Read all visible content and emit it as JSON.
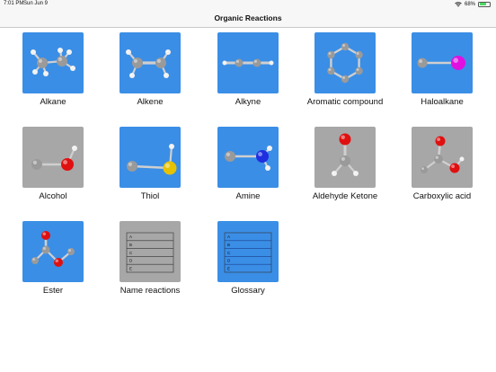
{
  "status": {
    "time": "7:01 PM",
    "date": "Sun Jun 9",
    "battery": "68%",
    "battery_level": 0.68
  },
  "nav": {
    "title": "Organic Reactions"
  },
  "tiles": [
    {
      "label": "Alkane",
      "icon": "alkane-molecule-icon",
      "bg": "blue"
    },
    {
      "label": "Alkene",
      "icon": "alkene-molecule-icon",
      "bg": "blue"
    },
    {
      "label": "Alkyne",
      "icon": "alkyne-molecule-icon",
      "bg": "blue"
    },
    {
      "label": "Aromatic compound",
      "icon": "aromatic-molecule-icon",
      "bg": "blue"
    },
    {
      "label": "Haloalkane",
      "icon": "haloalkane-molecule-icon",
      "bg": "blue"
    },
    {
      "label": "Alcohol",
      "icon": "alcohol-molecule-icon",
      "bg": "gray"
    },
    {
      "label": "Thiol",
      "icon": "thiol-molecule-icon",
      "bg": "blue"
    },
    {
      "label": "Amine",
      "icon": "amine-molecule-icon",
      "bg": "blue"
    },
    {
      "label": "Aldehyde Ketone",
      "icon": "carbonyl-molecule-icon",
      "bg": "gray"
    },
    {
      "label": "Carboxylic acid",
      "icon": "carboxylic-acid-molecule-icon",
      "bg": "gray"
    },
    {
      "label": "Ester",
      "icon": "ester-molecule-icon",
      "bg": "blue"
    },
    {
      "label": "Name reactions",
      "icon": "table-list-icon",
      "bg": "gray"
    },
    {
      "label": "Glossary",
      "icon": "glossary-list-icon",
      "bg": "blue"
    }
  ],
  "list_rows": [
    "A",
    "B",
    "C",
    "D",
    "E"
  ],
  "colors": {
    "tile_blue": "#3a8ee6",
    "tile_gray": "#a7a7a7",
    "carbon": "#9a9a9a",
    "hydrogen": "#f2f2f2",
    "oxygen": "#e01010",
    "nitrogen": "#1f2fe0",
    "sulfur": "#e6c200",
    "halogen": "#e010e0"
  }
}
